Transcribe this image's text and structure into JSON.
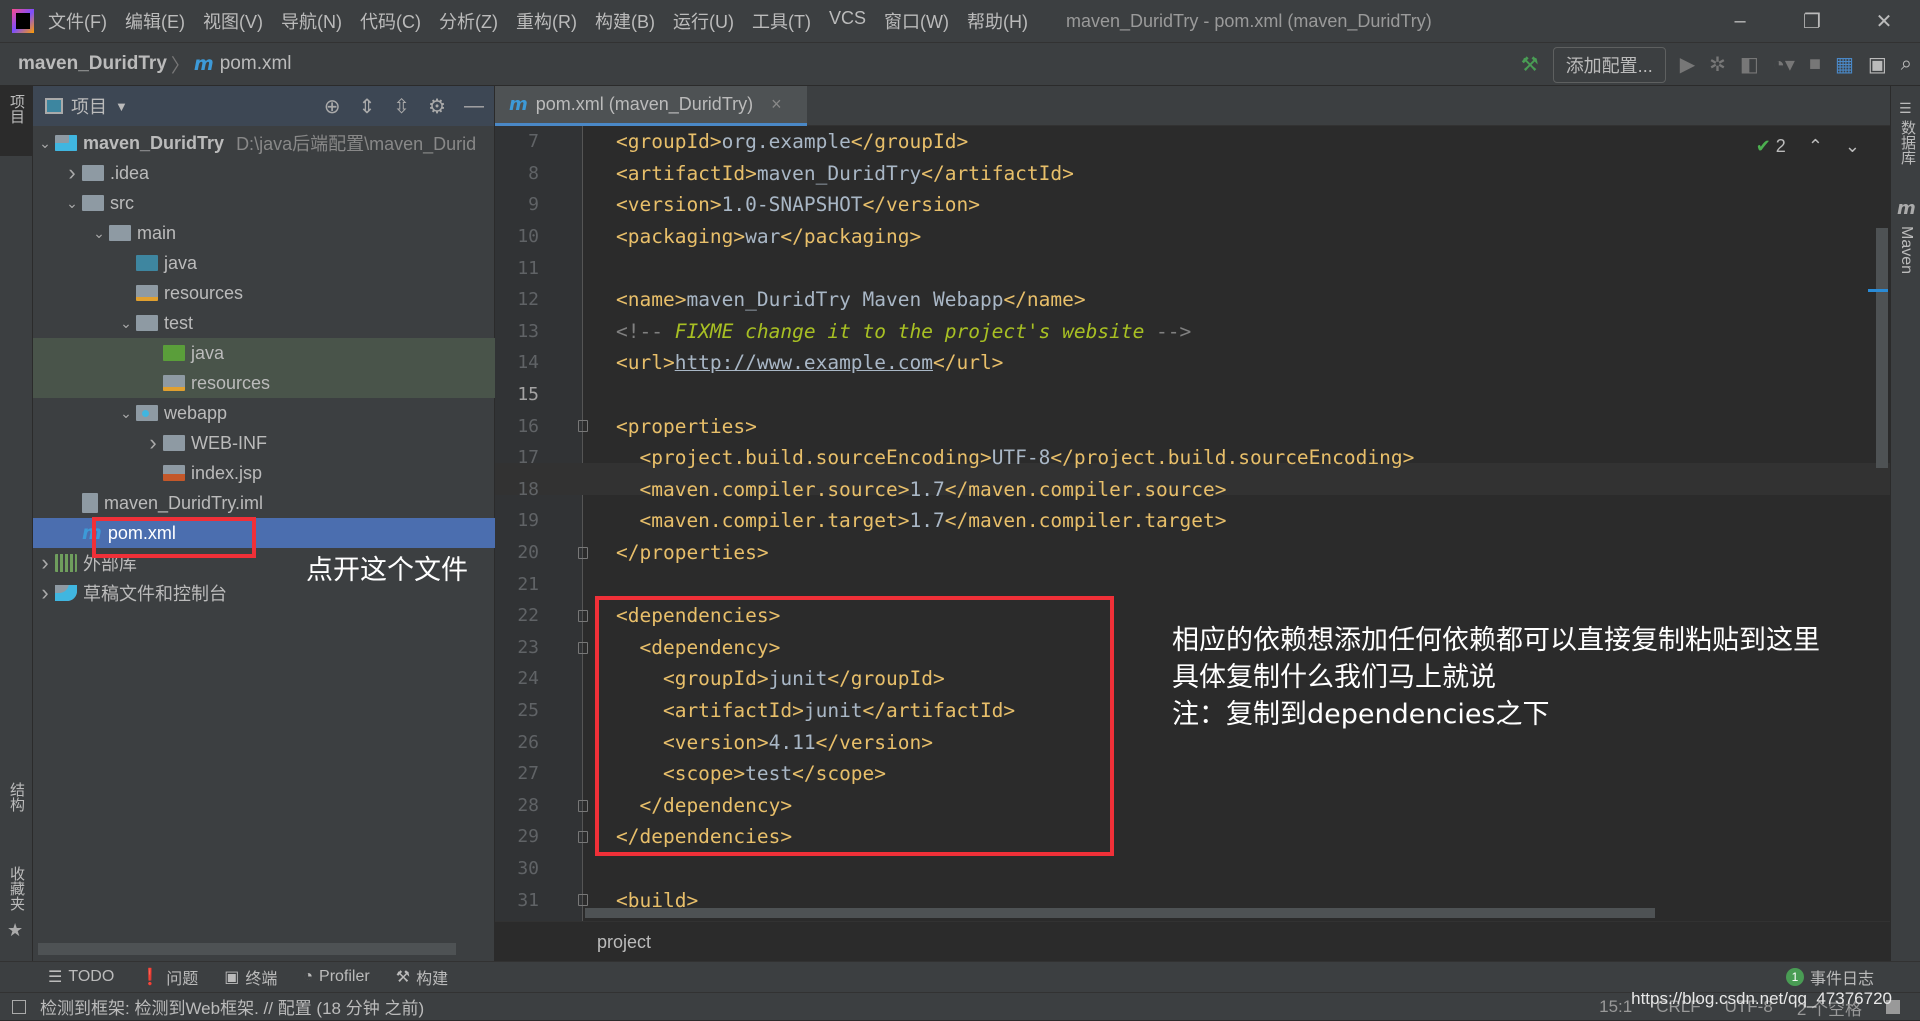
{
  "titlebar": {
    "menu": [
      "文件(F)",
      "编辑(E)",
      "视图(V)",
      "导航(N)",
      "代码(C)",
      "分析(Z)",
      "重构(R)",
      "构建(B)",
      "运行(U)",
      "工具(T)",
      "VCS",
      "窗口(W)",
      "帮助(H)"
    ],
    "window_title": "maven_DuridTry - pom.xml (maven_DuridTry)",
    "minimize": "–",
    "restore": "❐",
    "close": "✕"
  },
  "navbar": {
    "project": "maven_DuridTry",
    "sep": "〉",
    "file_icon": "m",
    "file": "pom.xml",
    "add_config": "添加配置...",
    "icons": [
      "hammer-icon",
      "run-icon",
      "debug-icon",
      "coverage-icon",
      "profile-icon",
      "stop-icon",
      "project-structure-icon",
      "run-anything-icon",
      "search-icon"
    ]
  },
  "left_stripe": {
    "project": "项目",
    "structure": "结构",
    "favorites": "收藏夹"
  },
  "project_panel": {
    "title": "项目",
    "tree": [
      {
        "depth": 0,
        "arrow": "v",
        "icon": "module",
        "label": "maven_DuridTry",
        "path": "D:\\java后端配置\\maven_Durid",
        "bold": true
      },
      {
        "depth": 1,
        "arrow": ">",
        "icon": "folder",
        "label": ".idea"
      },
      {
        "depth": 1,
        "arrow": "v",
        "icon": "folder",
        "label": "src"
      },
      {
        "depth": 2,
        "arrow": "v",
        "icon": "folder",
        "label": "main"
      },
      {
        "depth": 3,
        "arrow": "",
        "icon": "src",
        "label": "java"
      },
      {
        "depth": 3,
        "arrow": "",
        "icon": "res",
        "label": "resources"
      },
      {
        "depth": 3,
        "arrow": "v",
        "icon": "folder",
        "label": "test"
      },
      {
        "depth": 4,
        "arrow": "",
        "icon": "testsrc",
        "label": "java",
        "test": true
      },
      {
        "depth": 4,
        "arrow": "",
        "icon": "res",
        "label": "resources",
        "test": true
      },
      {
        "depth": 3,
        "arrow": "v",
        "icon": "web",
        "label": "webapp"
      },
      {
        "depth": 4,
        "arrow": ">",
        "icon": "folder",
        "label": "WEB-INF"
      },
      {
        "depth": 4,
        "arrow": "",
        "icon": "jsp",
        "label": "index.jsp"
      },
      {
        "depth": 1,
        "arrow": "",
        "icon": "iml",
        "label": "maven_DuridTry.iml"
      },
      {
        "depth": 1,
        "arrow": "",
        "icon": "maven",
        "label": "pom.xml",
        "selected": true
      },
      {
        "depth": 0,
        "arrow": ">",
        "icon": "lib",
        "label": "外部库"
      },
      {
        "depth": 0,
        "arrow": ">",
        "icon": "scratch",
        "label": "草稿文件和控制台"
      }
    ],
    "annotation": "点开这个文件"
  },
  "editor": {
    "tab_icon": "m",
    "tab_label": "pom.xml (maven_DuridTry)",
    "tab_close": "×",
    "inspection_count": "2",
    "current_line": 15,
    "lines": [
      {
        "n": 7,
        "s": [
          [
            "tag",
            "<groupId>"
          ],
          [
            "text",
            "org.example"
          ],
          [
            "tag",
            "</groupId>"
          ]
        ]
      },
      {
        "n": 8,
        "s": [
          [
            "tag",
            "<artifactId>"
          ],
          [
            "text",
            "maven_DuridTry"
          ],
          [
            "tag",
            "</artifactId>"
          ]
        ]
      },
      {
        "n": 9,
        "s": [
          [
            "tag",
            "<version>"
          ],
          [
            "text",
            "1.0-SNAPSHOT"
          ],
          [
            "tag",
            "</version>"
          ]
        ]
      },
      {
        "n": 10,
        "s": [
          [
            "tag",
            "<packaging>"
          ],
          [
            "text",
            "war"
          ],
          [
            "tag",
            "</packaging>"
          ]
        ]
      },
      {
        "n": 11,
        "s": []
      },
      {
        "n": 12,
        "s": [
          [
            "tag",
            "<name>"
          ],
          [
            "text",
            "maven_DuridTry Maven Webapp"
          ],
          [
            "tag",
            "</name>"
          ]
        ]
      },
      {
        "n": 13,
        "s": [
          [
            "comment",
            "<!-- "
          ],
          [
            "todo",
            "FIXME change it to the project's website"
          ],
          [
            "comment",
            " -->"
          ]
        ]
      },
      {
        "n": 14,
        "s": [
          [
            "tag",
            "<url>"
          ],
          [
            "url",
            "http://www.example.com"
          ],
          [
            "tag",
            "</url>"
          ]
        ]
      },
      {
        "n": 15,
        "s": []
      },
      {
        "n": 16,
        "fold": true,
        "s": [
          [
            "tag",
            "<properties>"
          ]
        ]
      },
      {
        "n": 17,
        "s": [
          [
            "tag",
            "  <project.build.sourceEncoding>"
          ],
          [
            "text",
            "UTF-8"
          ],
          [
            "tag",
            "</project.build.sourceEncoding>"
          ]
        ]
      },
      {
        "n": 18,
        "s": [
          [
            "tag",
            "  <maven.compiler.source>"
          ],
          [
            "text",
            "1.7"
          ],
          [
            "tag",
            "</maven.compiler.source>"
          ]
        ]
      },
      {
        "n": 19,
        "s": [
          [
            "tag",
            "  <maven.compiler.target>"
          ],
          [
            "text",
            "1.7"
          ],
          [
            "tag",
            "</maven.compiler.target>"
          ]
        ]
      },
      {
        "n": 20,
        "fold": true,
        "s": [
          [
            "tag",
            "</properties>"
          ]
        ]
      },
      {
        "n": 21,
        "s": []
      },
      {
        "n": 22,
        "fold": true,
        "s": [
          [
            "tag",
            "<dependencies>"
          ]
        ]
      },
      {
        "n": 23,
        "fold": true,
        "s": [
          [
            "tag",
            "  <dependency>"
          ]
        ]
      },
      {
        "n": 24,
        "s": [
          [
            "tag",
            "    <groupId>"
          ],
          [
            "text",
            "junit"
          ],
          [
            "tag",
            "</groupId>"
          ]
        ]
      },
      {
        "n": 25,
        "s": [
          [
            "tag",
            "    <artifactId>"
          ],
          [
            "text",
            "junit"
          ],
          [
            "tag",
            "</artifactId>"
          ]
        ]
      },
      {
        "n": 26,
        "s": [
          [
            "tag",
            "    <version>"
          ],
          [
            "text",
            "4.11"
          ],
          [
            "tag",
            "</version>"
          ]
        ]
      },
      {
        "n": 27,
        "s": [
          [
            "tag",
            "    <scope>"
          ],
          [
            "text",
            "test"
          ],
          [
            "tag",
            "</scope>"
          ]
        ]
      },
      {
        "n": 28,
        "fold": true,
        "s": [
          [
            "tag",
            "  </dependency>"
          ]
        ]
      },
      {
        "n": 29,
        "fold": true,
        "s": [
          [
            "tag",
            "</dependencies>"
          ]
        ]
      },
      {
        "n": 30,
        "s": []
      },
      {
        "n": 31,
        "fold": true,
        "s": [
          [
            "tag",
            "<build>"
          ]
        ]
      }
    ],
    "breadcrumb": "project",
    "annotation": [
      "相应的依赖想添加任何依赖都可以直接复制粘贴到这里",
      "具体复制什么我们马上就说",
      "注：复制到dependencies之下"
    ]
  },
  "right_stripe": {
    "database": "数据库",
    "maven_icon": "m",
    "maven": "Maven"
  },
  "tool_windows": [
    {
      "icon": "☰",
      "label": "TODO"
    },
    {
      "icon": "❗",
      "label": "问题"
    },
    {
      "icon": "▣",
      "label": "终端"
    },
    {
      "icon": "◔",
      "label": "Profiler"
    },
    {
      "icon": "⚒",
      "label": "构建"
    }
  ],
  "event_log": {
    "count": "1",
    "label": "事件日志"
  },
  "status": {
    "message": "检测到框架: 检测到Web框架. // 配置 (18 分钟 之前)",
    "position": "15:1",
    "line_sep": "CRLF",
    "encoding": "UTF-8",
    "indent": "2 个空格",
    "watermark": "https://blog.csdn.net/qq_47376720"
  },
  "colors": {
    "accent": "#4b6eaf",
    "tag": "#e8bf6a",
    "annotation_box": "#f03038"
  }
}
